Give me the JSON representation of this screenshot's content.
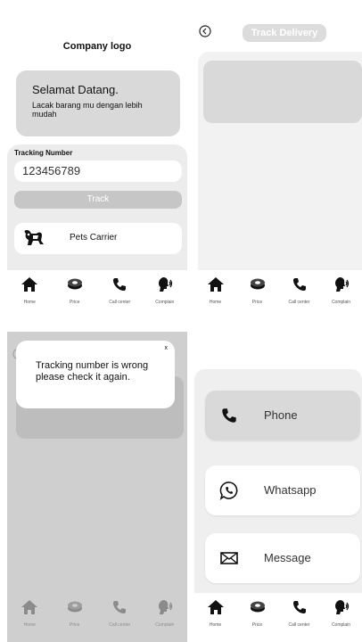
{
  "home": {
    "logo": "Company logo",
    "welcome_title": "Selamat Datang.",
    "welcome_sub": "Lacak barang mu dengan lebih mudah",
    "tracking_label": "Tracking Number",
    "tracking_value": "123456789",
    "track_button": "Track",
    "service": "Pets Carrier"
  },
  "track": {
    "title": "Track Delivery"
  },
  "error": {
    "message": "Tracking number is wrong please check it again.",
    "close": "x"
  },
  "contact": {
    "options": [
      {
        "label": "Phone",
        "icon": "phone-icon"
      },
      {
        "label": "Whatsapp",
        "icon": "whatsapp-icon"
      },
      {
        "label": "Message",
        "icon": "mail-icon"
      }
    ]
  },
  "nav": [
    {
      "label": "Home",
      "icon": "home-icon"
    },
    {
      "label": "Price",
      "icon": "money-icon"
    },
    {
      "label": "Call center",
      "icon": "phone-icon"
    },
    {
      "label": "Complain",
      "icon": "speaking-head-icon"
    }
  ]
}
